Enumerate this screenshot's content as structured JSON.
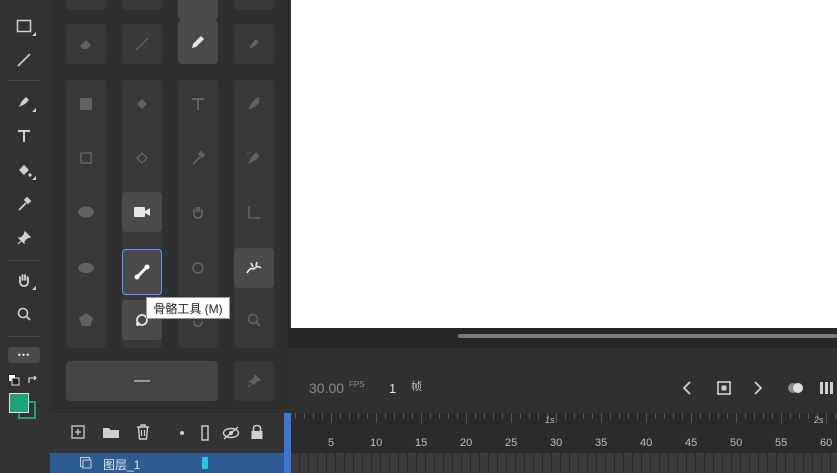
{
  "toolbar": {
    "more_label": "•••",
    "fill_color": "#1fa27a"
  },
  "panel": {
    "wide_button_label": "—",
    "tooltip": "骨骼工具 (M)"
  },
  "timeline": {
    "fps_value": "30.00",
    "fps_unit": "FPS",
    "frame_number": "1",
    "frame_unit": "帧",
    "ruler_seconds": [
      "1s",
      "2s"
    ],
    "ruler_frames": [
      "5",
      "10",
      "15",
      "20",
      "25",
      "30",
      "35",
      "40",
      "45",
      "50",
      "55",
      "60"
    ],
    "layer_name": "图层_1"
  },
  "colors": {
    "accent": "#5a9cf7",
    "playhead": "#3a78d8",
    "layer_row": "#2c5c93",
    "frame_marker": "#22c9e6"
  }
}
